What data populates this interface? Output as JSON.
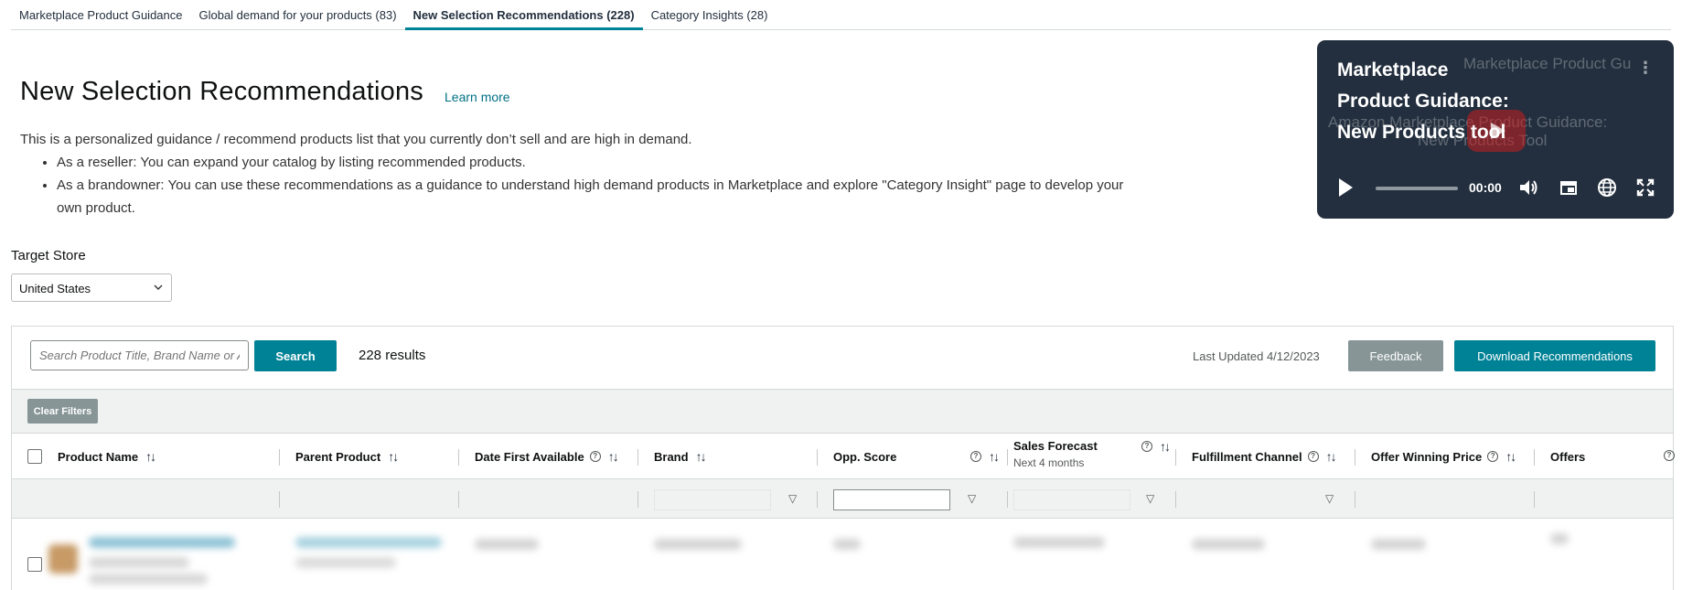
{
  "tabs": [
    {
      "label": "Marketplace Product Guidance",
      "active": false
    },
    {
      "label": "Global demand for your products (83)",
      "active": false
    },
    {
      "label": "New Selection Recommendations (228)",
      "active": true
    },
    {
      "label": "Category Insights (28)",
      "active": false
    }
  ],
  "header": {
    "title": "New Selection Recommendations",
    "learn_more": "Learn more"
  },
  "intro": {
    "text": "This is a personalized guidance / recommend products list that you currently don’t sell and are high in demand.",
    "bullets": [
      "As a reseller: You can expand your catalog by listing recommended products.",
      "As a brandowner: You can use these recommendations as a guidance to understand high demand products in Marketplace and explore \"Category Insight\" page to develop your own product."
    ]
  },
  "video": {
    "title": "Marketplace Product Guidance: New Products tool",
    "time": "00:00"
  },
  "store": {
    "label": "Target Store",
    "selected": "United States"
  },
  "toolbar": {
    "search_placeholder": "Search Product Title, Brand Name or ASIN",
    "search_label": "Search",
    "results": "228 results",
    "last_updated": "Last Updated 4/12/2023",
    "feedback_label": "Feedback",
    "download_label": "Download Recommendations",
    "clear_filters_label": "Clear Filters"
  },
  "table": {
    "columns": [
      {
        "label": "Product Name",
        "sub": ""
      },
      {
        "label": "Parent Product",
        "sub": ""
      },
      {
        "label": "Date First Available",
        "sub": ""
      },
      {
        "label": "Brand",
        "sub": ""
      },
      {
        "label": "Opp. Score",
        "sub": ""
      },
      {
        "label": "Sales Forecast",
        "sub": "Next 4 months"
      },
      {
        "label": "Fulfillment Channel",
        "sub": ""
      },
      {
        "label": "Offer Winning Price",
        "sub": ""
      },
      {
        "label": "Offers",
        "sub": ""
      }
    ]
  },
  "colors": {
    "accent": "#008296",
    "link": "#007185",
    "secondary_button": "#879596",
    "video_bg": "#232f3e"
  }
}
